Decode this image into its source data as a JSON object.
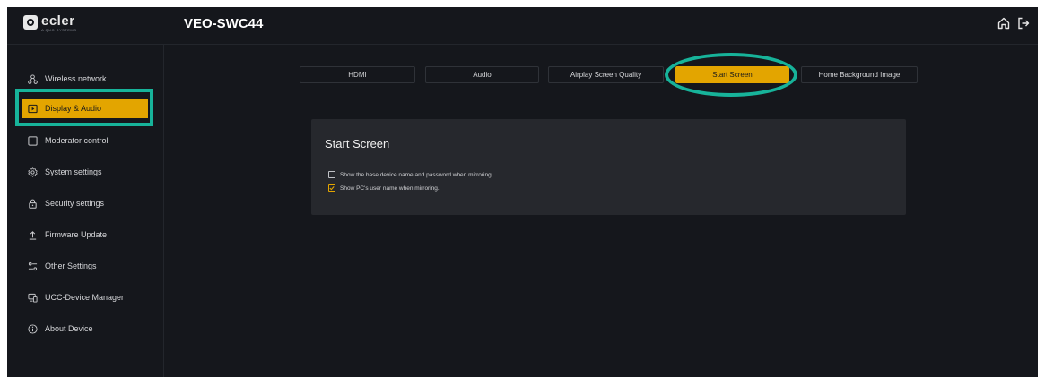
{
  "brand": {
    "name": "ecler",
    "tagline": "A QUO SYSTEMS"
  },
  "header": {
    "device_name": "VEO-SWC44",
    "icons": [
      "home-icon",
      "logout-icon"
    ]
  },
  "sidebar": {
    "items": [
      {
        "label": "Wireless network",
        "icon": "wireless-network-icon",
        "active": false
      },
      {
        "label": "Display & Audio",
        "icon": "display-play-icon",
        "active": true
      },
      {
        "label": "Moderator control",
        "icon": "moderator-square-icon",
        "active": false
      },
      {
        "label": "System settings",
        "icon": "gear-icon",
        "active": false
      },
      {
        "label": "Security settings",
        "icon": "lock-icon",
        "active": false
      },
      {
        "label": "Firmware Update",
        "icon": "upload-icon",
        "active": false
      },
      {
        "label": "Other Settings",
        "icon": "settings-sliders-icon",
        "active": false
      },
      {
        "label": "UCC-Device Manager",
        "icon": "device-manager-icon",
        "active": false
      },
      {
        "label": "About Device",
        "icon": "info-icon",
        "active": false
      }
    ]
  },
  "tabs": [
    {
      "label": "HDMI",
      "active": false
    },
    {
      "label": "Audio",
      "active": false
    },
    {
      "label": "Airplay Screen Quality",
      "active": false
    },
    {
      "label": "Start Screen",
      "active": true
    },
    {
      "label": "Home Background Image",
      "active": false
    }
  ],
  "panel": {
    "title": "Start Screen",
    "options": [
      {
        "label": "Show the base device name and password when mirroring.",
        "checked": false
      },
      {
        "label": "Show PC's user name when mirroring.",
        "checked": true
      }
    ]
  },
  "colors": {
    "accent": "#e3a500",
    "highlight": "#17b39a",
    "background": "#15171c",
    "panel": "#26282d"
  }
}
